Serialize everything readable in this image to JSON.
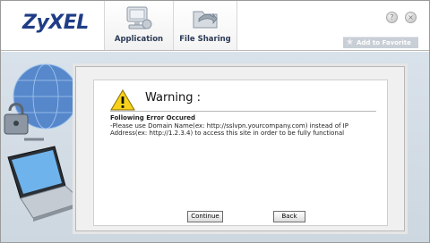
{
  "brand": {
    "logo_text": "ZyXEL"
  },
  "nav": {
    "tabs": [
      {
        "label": "Application",
        "icon": "computer-icon"
      },
      {
        "label": "File Sharing",
        "icon": "folder-share-icon"
      }
    ]
  },
  "window_controls": {
    "help_icon": "help-icon",
    "close_icon": "close-icon"
  },
  "favorites": {
    "label": "Add to Favorite",
    "icon": "star-icon"
  },
  "dialog": {
    "title": "Warning :",
    "icon": "warning-icon",
    "error_heading": "Following Error Occured",
    "error_message": "-Please use Domain Name(ex: http://sslvpn.yourcompany.com) instead of IP Address(ex: http://1.2.3.4) to access this site in order to be fully functional",
    "continue_label": "Continue",
    "back_label": "Back"
  },
  "colors": {
    "brand_blue": "#1f3d86",
    "warning_yellow": "#f7d21a",
    "background_blue": "#d3dce5"
  }
}
